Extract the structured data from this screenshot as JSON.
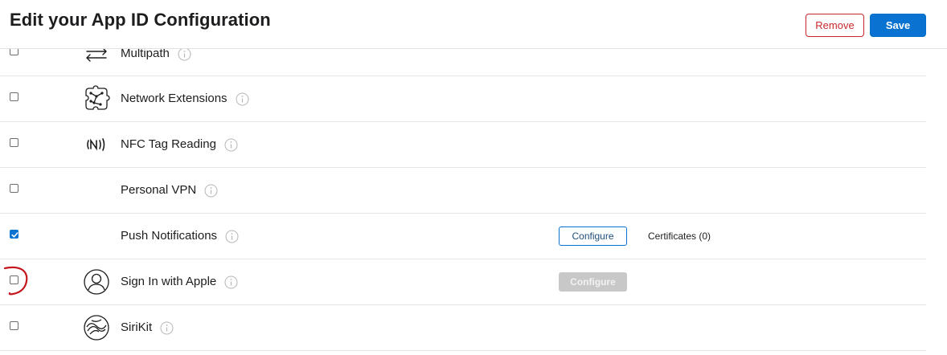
{
  "header": {
    "title": "Edit your App ID Configuration",
    "remove_label": "Remove",
    "save_label": "Save"
  },
  "capabilities": [
    {
      "label": "Multipath",
      "checked": false,
      "icon": "multipath-arrows-icon"
    },
    {
      "label": "Network Extensions",
      "checked": false,
      "icon": "network-extensions-icon"
    },
    {
      "label": "NFC Tag Reading",
      "checked": false,
      "icon": "nfc-icon"
    },
    {
      "label": "Personal VPN",
      "checked": false,
      "icon": ""
    },
    {
      "label": "Push Notifications",
      "checked": true,
      "icon": "",
      "configure_label": "Configure",
      "certificates_label": "Certificates (0)"
    },
    {
      "label": "Sign In with Apple",
      "checked": false,
      "icon": "person-circle-icon",
      "configure_label": "Configure",
      "configure_disabled": true
    },
    {
      "label": "SiriKit",
      "checked": false,
      "icon": "siri-icon"
    }
  ],
  "colors": {
    "accent": "#0a72d1",
    "remove": "#c8282d",
    "annotation": "#c4161c"
  }
}
